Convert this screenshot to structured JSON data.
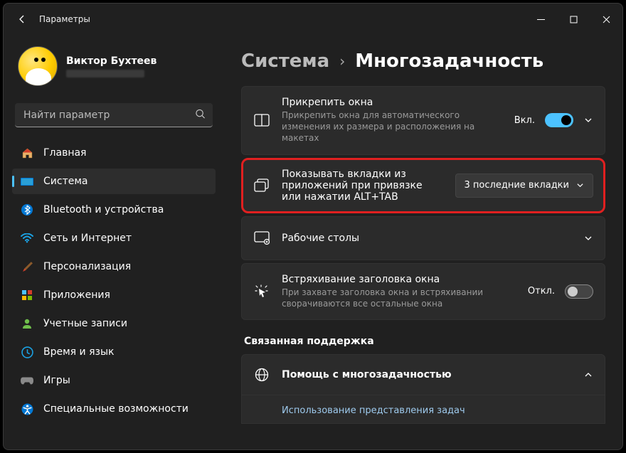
{
  "titlebar": {
    "title": "Параметры"
  },
  "profile": {
    "name": "Виктор Бухтеев"
  },
  "search": {
    "placeholder": "Найти параметр"
  },
  "nav": {
    "items": [
      {
        "label": "Главная"
      },
      {
        "label": "Система"
      },
      {
        "label": "Bluetooth и устройства"
      },
      {
        "label": "Сеть и Интернет"
      },
      {
        "label": "Персонализация"
      },
      {
        "label": "Приложения"
      },
      {
        "label": "Учетные записи"
      },
      {
        "label": "Время и язык"
      },
      {
        "label": "Игры"
      },
      {
        "label": "Специальные возможности"
      }
    ]
  },
  "breadcrumb": {
    "parent": "Система",
    "sep": "›",
    "current": "Многозадачность"
  },
  "cards": {
    "snap": {
      "title": "Прикрепить окна",
      "sub": "Прикрепить окна для автоматического изменения их размера и расположения на макетах",
      "state_label": "Вкл."
    },
    "alttab": {
      "title": "Показывать вкладки из приложений при привязке или нажатии ALT+TAB",
      "dropdown": "3 последние вкладки"
    },
    "desktops": {
      "title": "Рабочие столы"
    },
    "shake": {
      "title": "Встряхивание заголовка окна",
      "sub": "При захвате заголовка окна и встряхивании сворачиваются все остальные окна",
      "state_label": "Откл."
    }
  },
  "related": {
    "header": "Связанная поддержка",
    "help_title": "Помощь с многозадачностью",
    "help_link": "Использование представления задач"
  }
}
